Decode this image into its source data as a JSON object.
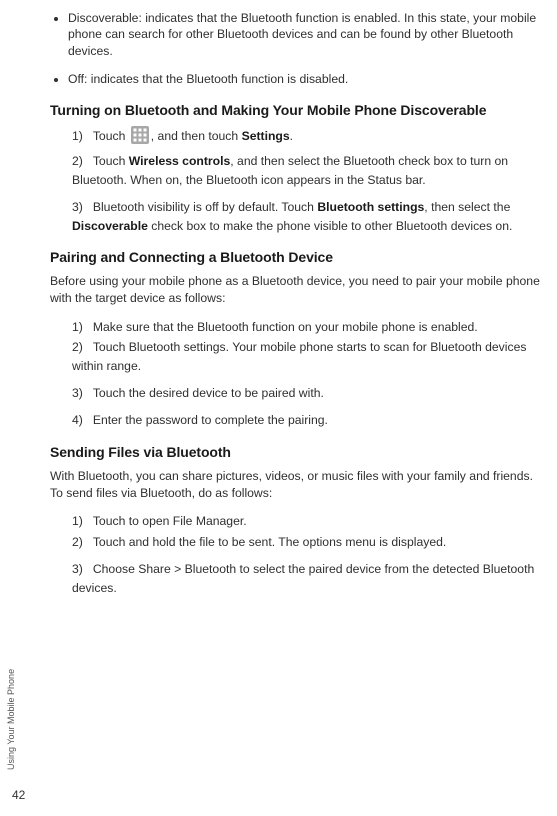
{
  "top_bullets": {
    "b1": "Discoverable: indicates that the Bluetooth function is enabled. In this state, your mobile phone can search for other Bluetooth devices and can be found by other Bluetooth devices.",
    "b2": "Off: indicates that the Bluetooth function is disabled."
  },
  "section1": {
    "heading": "Turning on Bluetooth and Making Your Mobile Phone Discoverable",
    "s1p1a": "Touch ",
    "s1p1b": ", and then touch ",
    "s1p1c": "Settings",
    "s1p1d": ".",
    "s2a": "Touch ",
    "s2b": "Wireless controls",
    "s2c": ", and then select the Bluetooth check box to turn on Bluetooth. When on, the Bluetooth icon appears in the Status bar.",
    "s3a": "Bluetooth visibility is off by default. Touch ",
    "s3b": "Bluetooth settings",
    "s3c": ", then select the ",
    "s3d": "Discoverable",
    "s3e": " check box to make the phone visible to other Bluetooth devices on."
  },
  "section2": {
    "heading": "Pairing and Connecting a Bluetooth Device",
    "intro": "Before using your mobile phone as a Bluetooth device, you need to pair your mobile phone with the target device as follows:",
    "s1": "Make sure that the Bluetooth function on your mobile phone is enabled.",
    "s2": "Touch Bluetooth settings. Your mobile phone starts to scan for Bluetooth devices within range.",
    "s3": "Touch the desired device to be paired with.",
    "s4": "Enter the password to complete the pairing."
  },
  "section3": {
    "heading": "Sending Files via Bluetooth",
    "intro": "With Bluetooth, you can share pictures, videos, or music files with your family and friends. To send files via Bluetooth, do as follows:",
    "s1": "Touch to open File Manager.",
    "s2": "Touch and hold the file to be sent. The options menu is displayed.",
    "s3": "Choose Share > Bluetooth to select the paired device from the detected Bluetooth devices."
  },
  "labels": {
    "n1": "1)",
    "n2": "2)",
    "n3": "3)",
    "n4": "4)"
  },
  "footer": {
    "vertical": "Using Your Mobile Phone",
    "page": "42"
  },
  "icons": {
    "grid": "apps-grid-icon"
  }
}
